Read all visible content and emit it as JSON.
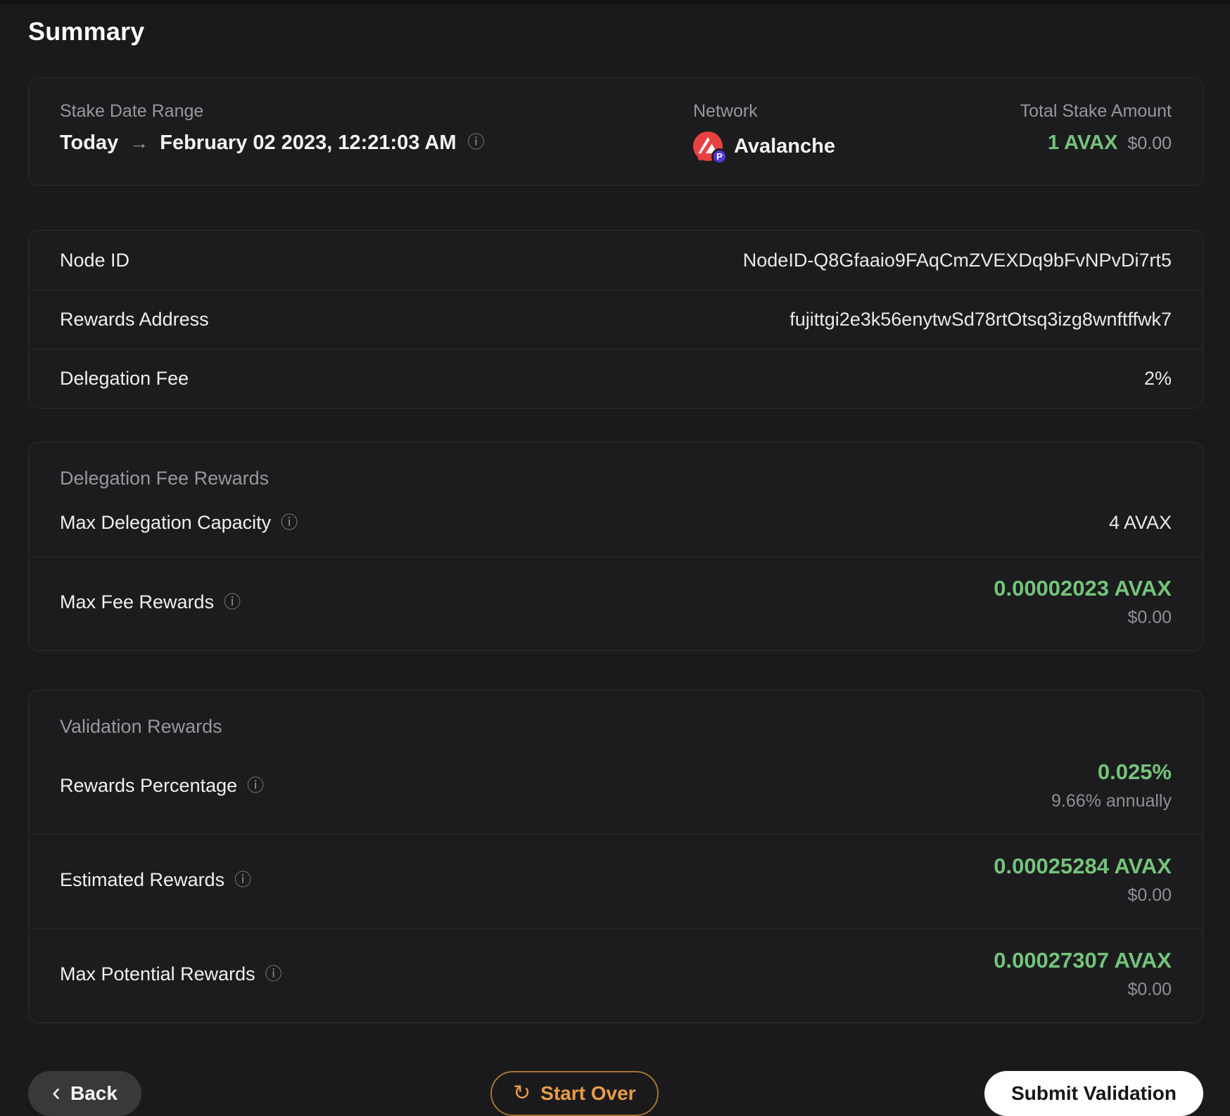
{
  "page": {
    "title": "Summary"
  },
  "colors": {
    "accent_green": "#73c47a",
    "accent_orange": "#e99c45",
    "avalanche_red": "#e84142",
    "badge_purple": "#5438dc"
  },
  "icons": {
    "arrow_right": "→",
    "info": "ⓘ",
    "chevron_left": "‹",
    "refresh": "↻",
    "p_badge": "P"
  },
  "overview": {
    "stake_date_range": {
      "label": "Stake Date Range",
      "from": "Today",
      "to": "February 02 2023, 12:21:03 AM"
    },
    "network": {
      "label": "Network",
      "value": "Avalanche"
    },
    "total_stake": {
      "label": "Total Stake Amount",
      "amount": "1 AVAX",
      "usd": "$0.00"
    }
  },
  "details_card": {
    "rows": [
      {
        "label": "Node ID",
        "value": "NodeID-Q8Gfaaio9FAqCmZVEXDq9bFvNPvDi7rt5"
      },
      {
        "label": "Rewards Address",
        "value": "fujittgi2e3k56enytwSd78rtOtsq3izg8wnftffwk7"
      },
      {
        "label": "Delegation Fee",
        "value": "2%"
      }
    ]
  },
  "delegation_fee_rewards": {
    "header": "Delegation Fee Rewards",
    "max_delegation_capacity": {
      "label": "Max Delegation Capacity",
      "value": "4 AVAX"
    },
    "max_fee_rewards": {
      "label": "Max Fee Rewards",
      "value": "0.00002023 AVAX",
      "usd": "$0.00"
    }
  },
  "validation_rewards": {
    "header": "Validation Rewards",
    "rewards_percentage": {
      "label": "Rewards Percentage",
      "value": "0.025%",
      "sub": "9.66% annually"
    },
    "estimated_rewards": {
      "label": "Estimated Rewards",
      "value": "0.00025284 AVAX",
      "sub": "$0.00"
    },
    "max_potential_rewards": {
      "label": "Max Potential Rewards",
      "value": "0.00027307 AVAX",
      "sub": "$0.00"
    }
  },
  "footer": {
    "back_label": "Back",
    "start_over_label": "Start Over",
    "submit_label": "Submit Validation"
  }
}
